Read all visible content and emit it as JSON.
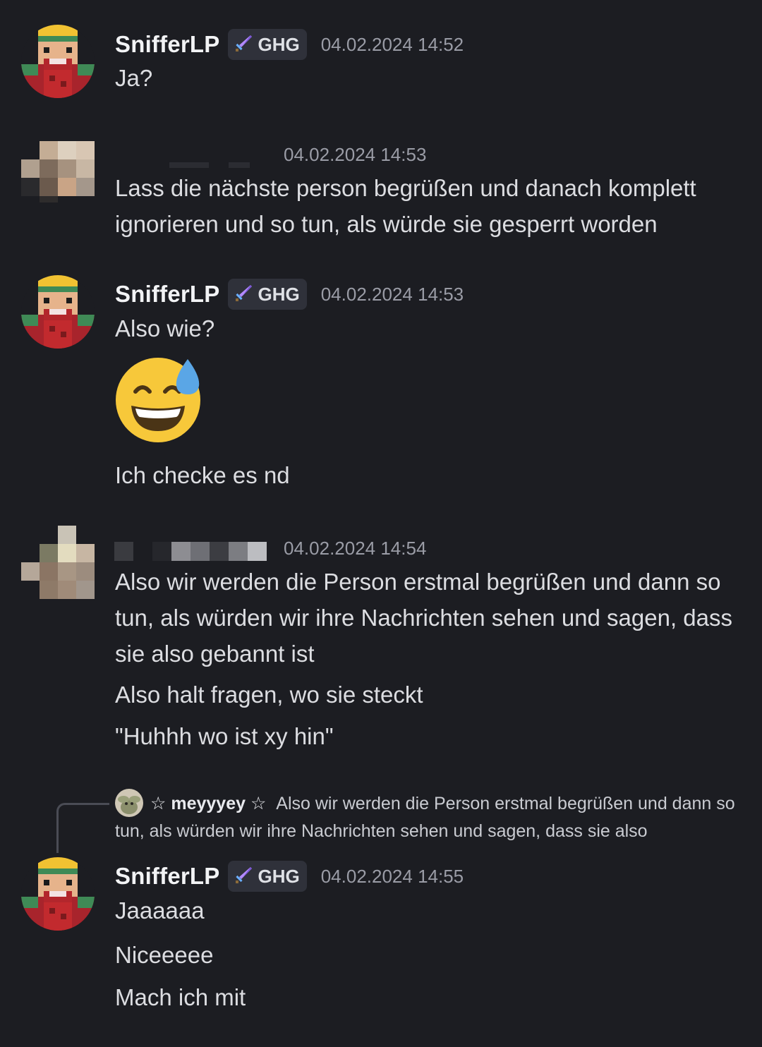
{
  "messages": [
    {
      "author": "SnifferLP",
      "role_tag": "GHG",
      "timestamp": "04.02.2024 14:52",
      "lines": [
        "Ja?"
      ]
    },
    {
      "author": "",
      "timestamp": "04.02.2024 14:53",
      "lines": [
        "Lass die nächste person begrüßen und danach komplett ignorieren und so tun, als würde sie gesperrt worden"
      ]
    },
    {
      "author": "SnifferLP",
      "role_tag": "GHG",
      "timestamp": "04.02.2024 14:53",
      "lines": [
        "Also wie?",
        "Ich checke es nd"
      ],
      "emoji": "grinning-face-with-sweat"
    },
    {
      "author": "",
      "timestamp": "04.02.2024 14:54",
      "lines": [
        "Also wir werden die Person erstmal begrüßen und dann so tun, als würden wir ihre Nachrichten sehen und sagen, dass sie also gebannt ist",
        "Also halt fragen, wo sie steckt",
        "\"Huhhh wo ist xy hin\""
      ]
    },
    {
      "author": "SnifferLP",
      "role_tag": "GHG",
      "timestamp": "04.02.2024 14:55",
      "reply": {
        "author": "☆ meyyyey ☆",
        "text": "Also wir werden die Person erstmal begrüßen und dann so tun, als würden wir ihre Nachrichten sehen und sagen, dass sie also"
      },
      "lines": [
        "Jaaaaaa",
        "Niceeeee",
        "Mach ich mit"
      ]
    }
  ],
  "colors": {
    "background": "#1c1d22",
    "username": "#f2f3f5",
    "timestamp": "#9a9ca6",
    "tag_bg": "#2f313a",
    "text": "#dcdde1"
  },
  "icons": [
    "sword-role-icon",
    "minecraft-avatar",
    "pixelated-avatar",
    "grinning-face-with-sweat-emoji"
  ]
}
